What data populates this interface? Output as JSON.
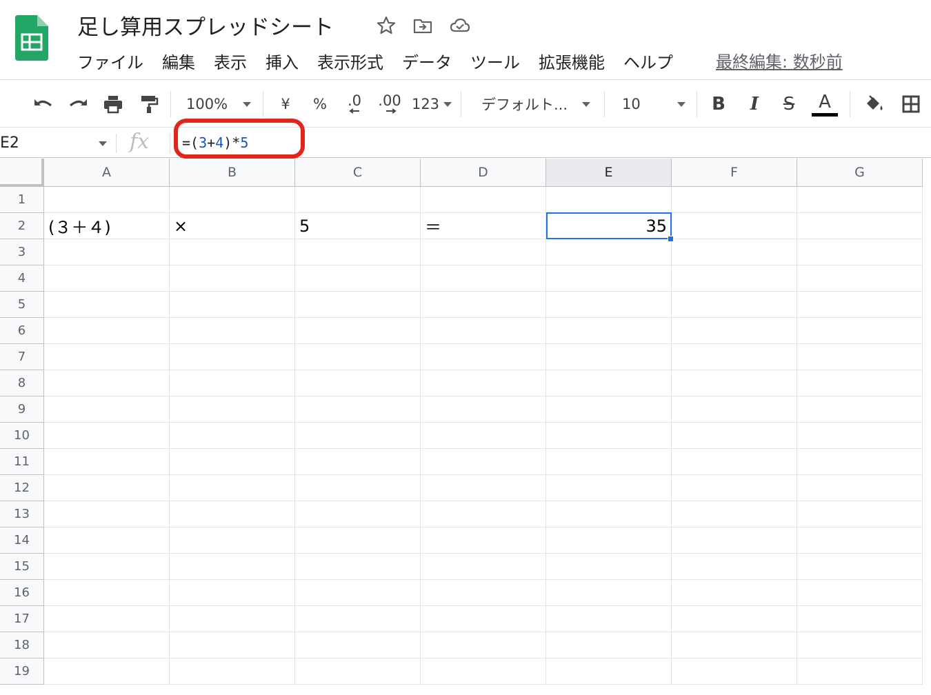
{
  "app": {
    "doc_title": "足し算用スプレッドシート",
    "last_edit": "最終編集: 数秒前"
  },
  "menu": [
    "ファイル",
    "編集",
    "表示",
    "挿入",
    "表示形式",
    "データ",
    "ツール",
    "拡張機能",
    "ヘルプ"
  ],
  "toolbar": {
    "zoom": "100%",
    "currency": "¥",
    "percent": "%",
    "decrease_decimal": ".0",
    "increase_decimal": ".00",
    "more_formats": "123",
    "font_family": "デフォルト...",
    "font_size": "10",
    "bold": "B",
    "italic": "I",
    "strikethrough": "S",
    "text_color": "A"
  },
  "formula_bar": {
    "name_box": "E2",
    "fx": "fx",
    "formula_parts": [
      "=(",
      "3",
      "+",
      "4",
      ")*",
      "5"
    ]
  },
  "sheet": {
    "columns": [
      "A",
      "B",
      "C",
      "D",
      "E",
      "F",
      "G"
    ],
    "rows": [
      "1",
      "2",
      "3",
      "4",
      "5",
      "6",
      "7",
      "8",
      "9",
      "10",
      "11",
      "12",
      "13",
      "14",
      "15",
      "16",
      "17",
      "18",
      "19"
    ],
    "selected_cell": "E2",
    "cells": {
      "A2": "(３＋４)",
      "B2": "×",
      "C2": "5",
      "D2": "＝",
      "E2": "35"
    }
  },
  "colors": {
    "accent": "#1a73e8",
    "highlight": "#e0251b",
    "formula_ref": "#1155cc",
    "sheets_green": "#23a566"
  }
}
